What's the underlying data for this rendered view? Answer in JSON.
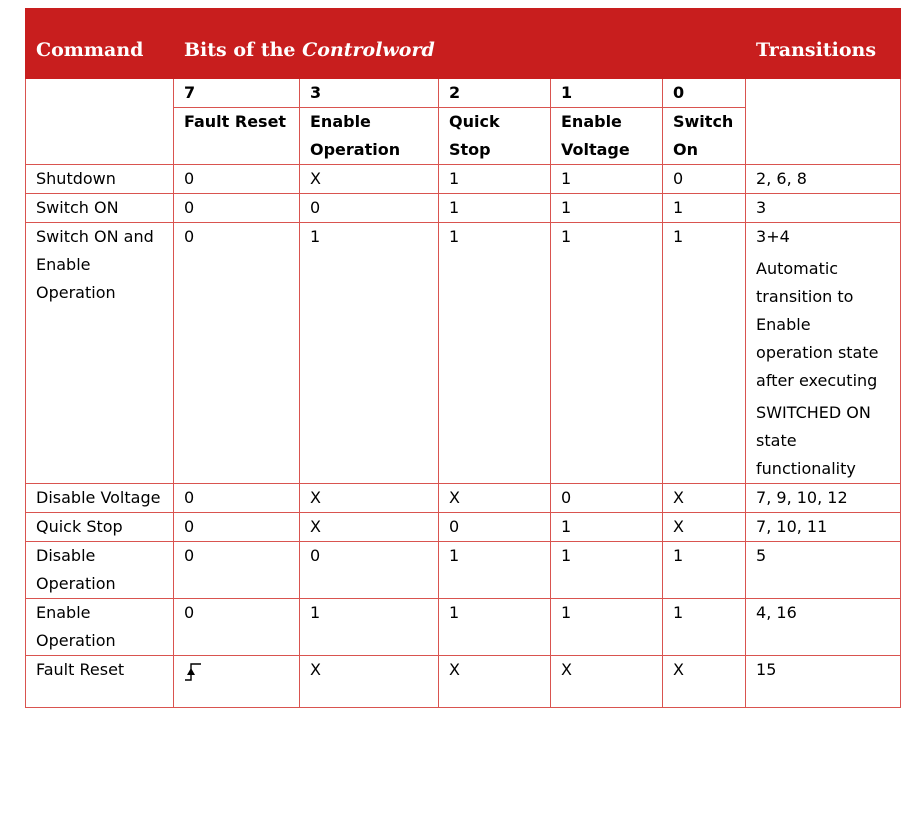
{
  "header": {
    "command": "Command",
    "bits_prefix": "Bits of the ",
    "bits_em": "Controlword",
    "transitions": "Transitions"
  },
  "bit_numbers": [
    "7",
    "3",
    "2",
    "1",
    "0"
  ],
  "bit_names": [
    "Fault Reset",
    "Enable Operation",
    "Quick Stop",
    "Enable Voltage",
    "Switch On"
  ],
  "rows": [
    {
      "command": "Shutdown",
      "bits": [
        "0",
        "X",
        "1",
        "1",
        "0"
      ],
      "transitions": "2, 6, 8"
    },
    {
      "command": "Switch ON",
      "bits": [
        "0",
        "0",
        "1",
        "1",
        "1"
      ],
      "transitions": "3"
    },
    {
      "command": "Switch ON and Enable Operation",
      "bits": [
        "0",
        "1",
        "1",
        "1",
        "1"
      ],
      "transitions": "3+4",
      "transitions_note1": "Automatic transition to Enable operation state after executing",
      "transitions_note2": "SWITCHED ON state functionality"
    },
    {
      "command": "Disable Voltage",
      "bits": [
        "0",
        "X",
        "X",
        "0",
        "X"
      ],
      "transitions": "7, 9, 10, 12"
    },
    {
      "command": "Quick Stop",
      "bits": [
        "0",
        "X",
        "0",
        "1",
        "X"
      ],
      "transitions": "7, 10, 11"
    },
    {
      "command": "Disable Operation",
      "bits": [
        "0",
        "0",
        "1",
        "1",
        "1"
      ],
      "transitions": "5"
    },
    {
      "command": "Enable Operation",
      "bits": [
        "0",
        "1",
        "1",
        "1",
        "1"
      ],
      "transitions": "4, 16"
    },
    {
      "command": "Fault Reset",
      "bits": [
        "",
        "X",
        "X",
        "X",
        "X"
      ],
      "bit7_icon": "rising-edge-icon",
      "transitions": "15"
    }
  ],
  "colors": {
    "header_bg": "#c81e1e",
    "grid": "#d9534f",
    "header_text": "#ffffff"
  }
}
